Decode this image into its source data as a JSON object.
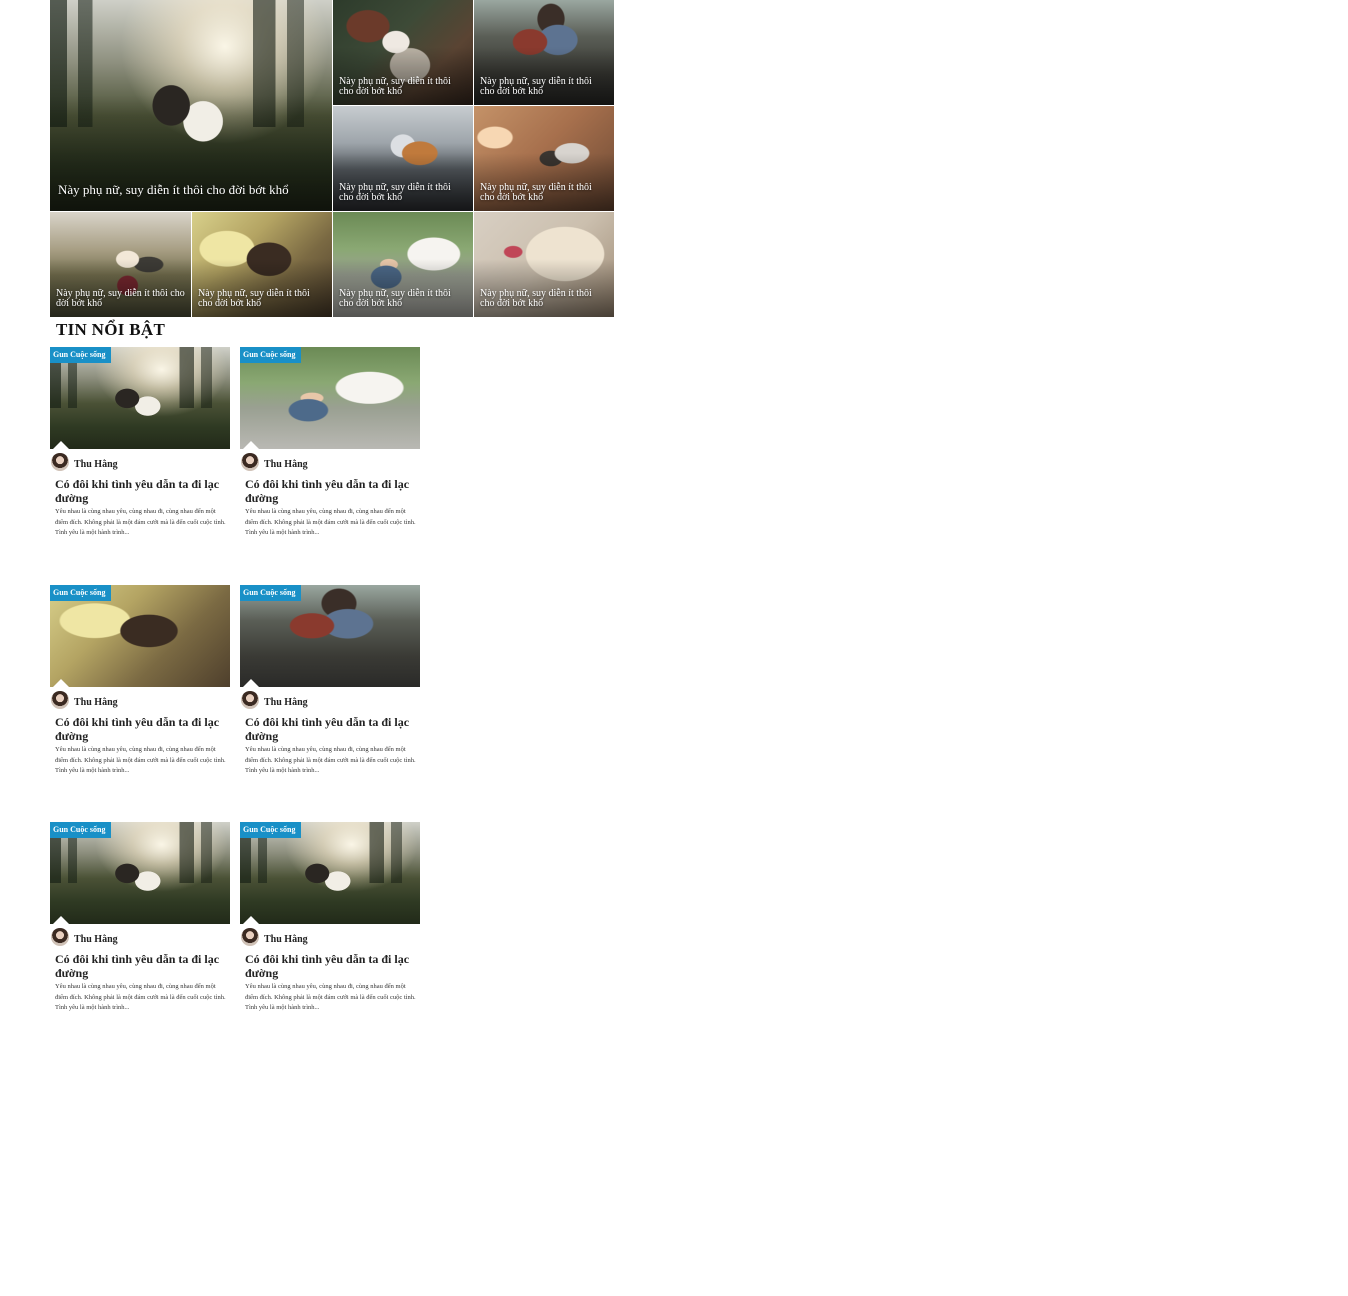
{
  "hero_grid": {
    "tiles": [
      {
        "caption": "Này phụ nữ, suy diễn ít thôi cho đời bớt khổ",
        "image": "couple-dancing-forest"
      },
      {
        "caption": "Này phụ nữ, suy diễn ít thôi cho đời bớt khổ",
        "image": "pouring-coffee"
      },
      {
        "caption": "Này phụ nữ, suy diễn ít thôi cho đời bớt khổ",
        "image": "couple-kissing-rocks"
      },
      {
        "caption": "Này phụ nữ, suy diễn ít thôi cho đời bớt khổ",
        "image": "couple-on-boat"
      },
      {
        "caption": "Này phụ nữ, suy diễn ít thôi cho đời bớt khổ",
        "image": "couple-kitchen"
      },
      {
        "caption": "Này phụ nữ, suy diễn ít thôi cho đời bớt khổ",
        "image": "couple-field"
      },
      {
        "caption": "Này phụ nữ, suy diễn ít thôi cho đời bớt khổ",
        "image": "woman-hair-sunlight"
      },
      {
        "caption": "Này phụ nữ, suy diễn ít thôi cho đời bớt khổ",
        "image": "couple-under-tree"
      },
      {
        "caption": "Này phụ nữ, suy diễn ít thôi cho đời bớt khổ",
        "image": "open-book-flower"
      }
    ]
  },
  "featured": {
    "title": "TIN NỔI BẬT",
    "cards": [
      {
        "badge": "Gun Cuộc sống",
        "author": "Thu Hằng",
        "title": "Có đôi khi tình yêu dẫn ta đi lạc đường",
        "excerpt": "Yêu nhau là cùng nhau yêu, cùng nhau đi, cùng nhau đến một điểm đích. Không phải là một đám cưới mà là đến cuối cuộc tình. Tình yêu là một hành trình...",
        "image": "couple-dancing-forest"
      },
      {
        "badge": "Gun Cuộc sống",
        "author": "Thu Hằng",
        "title": "Có đôi khi tình yêu dẫn ta đi lạc đường",
        "excerpt": "Yêu nhau là cùng nhau yêu, cùng nhau đi, cùng nhau đến một điểm đích. Không phải là một đám cưới mà là đến cuối cuộc tình. Tình yêu là một hành trình...",
        "image": "couple-under-tree"
      },
      {
        "badge": "Gun Cuộc sống",
        "author": "Thu Hằng",
        "title": "Có đôi khi tình yêu dẫn ta đi lạc đường",
        "excerpt": "Yêu nhau là cùng nhau yêu, cùng nhau đi, cùng nhau đến một điểm đích. Không phải là một đám cưới mà là đến cuối cuộc tình. Tình yêu là một hành trình...",
        "image": "woman-hair-sunlight"
      },
      {
        "badge": "Gun Cuộc sống",
        "author": "Thu Hằng",
        "title": "Có đôi khi tình yêu dẫn ta đi lạc đường",
        "excerpt": "Yêu nhau là cùng nhau yêu, cùng nhau đi, cùng nhau đến một điểm đích. Không phải là một đám cưới mà là đến cuối cuộc tình. Tình yêu là một hành trình...",
        "image": "couple-kissing-rocks"
      },
      {
        "badge": "Gun Cuộc sống",
        "author": "Thu Hằng",
        "title": "Có đôi khi tình yêu dẫn ta đi lạc đường",
        "excerpt": "Yêu nhau là cùng nhau yêu, cùng nhau đi, cùng nhau đến một điểm đích. Không phải là một đám cưới mà là đến cuối cuộc tình. Tình yêu là một hành trình...",
        "image": "couple-dancing-forest"
      },
      {
        "badge": "Gun Cuộc sống",
        "author": "Thu Hằng",
        "title": "Có đôi khi tình yêu dẫn ta đi lạc đường",
        "excerpt": "Yêu nhau là cùng nhau yêu, cùng nhau đi, cùng nhau đến một điểm đích. Không phải là một đám cưới mà là đến cuối cuộc tình. Tình yêu là một hành trình...",
        "image": "couple-dancing-forest"
      }
    ]
  },
  "colors": {
    "badge_bg": "#1990c7",
    "caption_text": "#ffffff",
    "title_text": "#222222"
  }
}
